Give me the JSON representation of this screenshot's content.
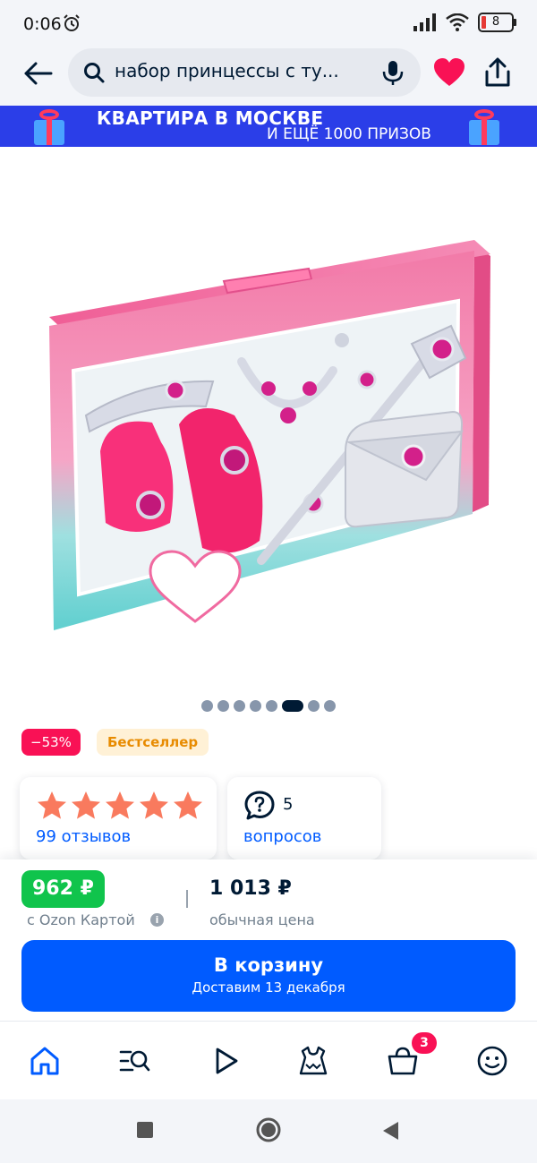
{
  "status_bar": {
    "time": "0:06",
    "battery": "8"
  },
  "search": {
    "query": "набор принцессы с ту..."
  },
  "promo": {
    "line1": "КВАРТИРА В МОСКВЕ",
    "line2": "И ЕЩЁ 1000 ПРИЗОВ"
  },
  "product": {
    "image_total": 8,
    "image_active_index": 5,
    "discount_badge": "−53%",
    "bestseller_badge": "Бестселлер",
    "rating_stars": 5,
    "reviews_label": "99 отзывов",
    "questions_count": "5",
    "questions_label": "вопросов"
  },
  "price": {
    "card_price": "962 ₽",
    "card_label": "с Ozon Картой",
    "info_icon": "i",
    "regular_price": "1 013 ₽",
    "regular_label": "обычная цена"
  },
  "cart_button": {
    "title": "В корзину",
    "subtitle": "Доставим 13 декабря"
  },
  "bottom_nav": {
    "cart_count": "3"
  },
  "colors": {
    "accent": "#005bff",
    "green_price": "#10c44c",
    "discount": "#f91155",
    "star": "#f97a5e",
    "promo": "#2b3ee8"
  }
}
